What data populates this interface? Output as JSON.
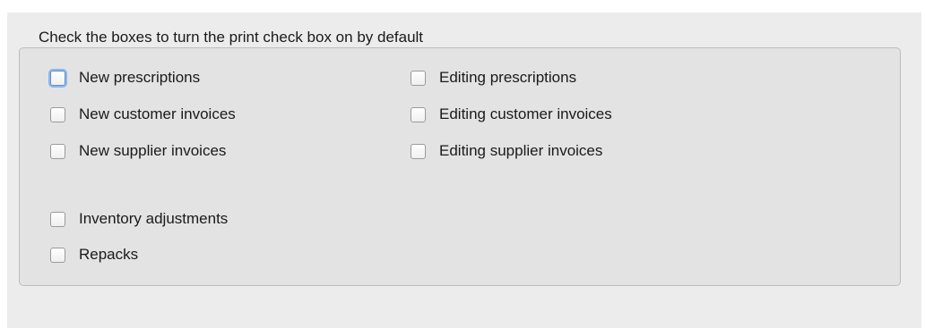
{
  "group": {
    "title": "Check the boxes to turn the print check box on by default"
  },
  "checkboxes": {
    "new_prescriptions": {
      "label": "New prescriptions",
      "checked": false,
      "focused": true
    },
    "new_customer_invoices": {
      "label": "New customer invoices",
      "checked": false
    },
    "new_supplier_invoices": {
      "label": "New supplier invoices",
      "checked": false
    },
    "inventory_adjustments": {
      "label": "Inventory adjustments",
      "checked": false
    },
    "repacks": {
      "label": "Repacks",
      "checked": false
    },
    "editing_prescriptions": {
      "label": "Editing prescriptions",
      "checked": false
    },
    "editing_customer_invoices": {
      "label": "Editing customer invoices",
      "checked": false
    },
    "editing_supplier_invoices": {
      "label": "Editing supplier invoices",
      "checked": false
    }
  },
  "colors": {
    "window_background": "#ececec",
    "group_background": "#e3e3e3",
    "focus_ring": "#8fb6e8"
  }
}
